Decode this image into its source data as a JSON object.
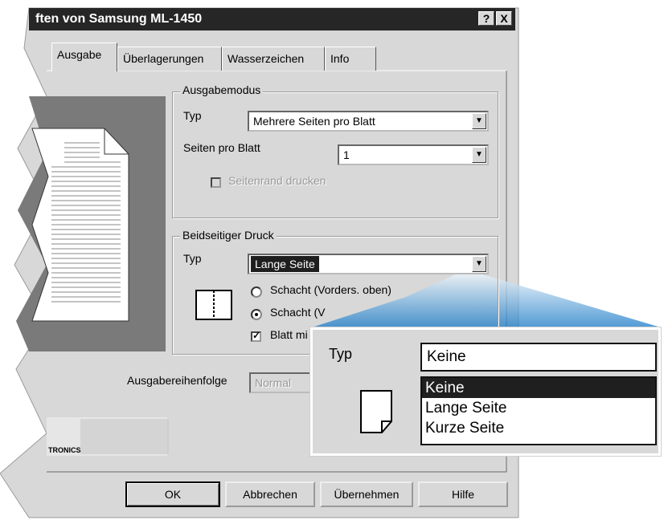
{
  "window": {
    "title": "ften von Samsung ML-1450",
    "help_button": "?",
    "close_button": "X"
  },
  "tabs": [
    "Ausgabe",
    "Überlagerungen",
    "Wasserzeichen",
    "Info"
  ],
  "ausgabemodus": {
    "legend": "Ausgabemodus",
    "typ_label": "Typ",
    "typ_value": "Mehrere Seiten pro Blatt",
    "seiten_label": "Seiten pro Blatt",
    "seiten_value": "1",
    "seitenrand_label": "Seitenrand drucken",
    "seitenrand_enabled": false
  },
  "duplex": {
    "legend": "Beidseitiger Druck",
    "typ_label": "Typ",
    "typ_value": "Lange Seite",
    "radio1_label": "Schacht (Vorders. oben)",
    "radio2_label": "Schacht (V",
    "checkbox_label": "Blatt mi",
    "checkbox_checked": true,
    "radio_selected": 2
  },
  "ausgabereihenfolge": {
    "label": "Ausgabereihenfolge",
    "value": "Normal"
  },
  "logo_text": "TRONICS",
  "buttons": {
    "ok": "OK",
    "cancel": "Abbrechen",
    "apply": "Übernehmen",
    "help": "Hilfe"
  },
  "zoom": {
    "typ_label": "Typ",
    "selected_value": "Keine",
    "options": [
      "Keine",
      "Lange Seite",
      "Kurze Seite"
    ],
    "highlighted_index": 0
  },
  "colors": {
    "dialog_face": "#d8d8d8",
    "titlebar": "#262626",
    "preview_bg": "#7a7a7a",
    "highlight": "#1f1f1f"
  }
}
